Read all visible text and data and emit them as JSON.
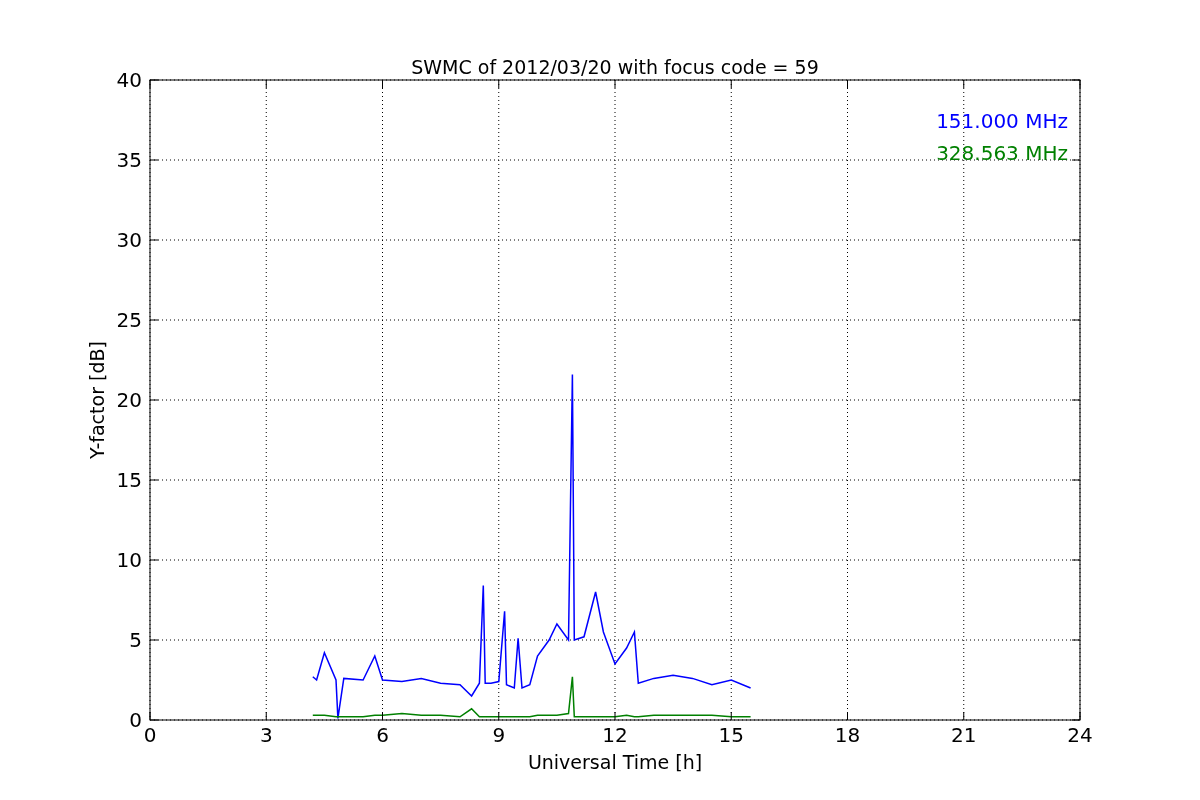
{
  "chart_data": {
    "type": "line",
    "title": "SWMC of 2012/03/20 with focus code = 59",
    "xlabel": "Universal Time [h]",
    "ylabel": "Y-factor [dB]",
    "x": [
      4.2,
      4.3,
      4.5,
      4.8,
      4.85,
      5.0,
      5.5,
      5.8,
      6.0,
      6.5,
      7.0,
      7.5,
      8.0,
      8.3,
      8.5,
      8.6,
      8.65,
      8.8,
      9.0,
      9.15,
      9.2,
      9.4,
      9.5,
      9.6,
      9.8,
      10.0,
      10.3,
      10.5,
      10.8,
      10.9,
      10.95,
      11.2,
      11.5,
      11.7,
      12.0,
      12.3,
      12.5,
      12.6,
      13.0,
      13.5,
      14.0,
      14.5,
      15.0,
      15.5
    ],
    "series": [
      {
        "name": "151.000 MHz",
        "color": "#0000ff",
        "values": [
          2.7,
          2.5,
          4.2,
          2.5,
          0.1,
          2.6,
          2.5,
          4.0,
          2.5,
          2.4,
          2.6,
          2.3,
          2.2,
          1.5,
          2.3,
          8.4,
          2.3,
          2.3,
          2.4,
          6.8,
          2.2,
          2.0,
          5.1,
          2.0,
          2.2,
          4.0,
          5.0,
          6.0,
          5.0,
          21.6,
          5.0,
          5.2,
          8.0,
          5.5,
          3.5,
          4.5,
          5.5,
          2.3,
          2.6,
          2.8,
          2.6,
          2.2,
          2.5,
          2.0
        ]
      },
      {
        "name": "328.563 MHz",
        "color": "#008000",
        "values": [
          0.3,
          0.3,
          0.3,
          0.2,
          0.2,
          0.2,
          0.2,
          0.3,
          0.3,
          0.4,
          0.3,
          0.3,
          0.2,
          0.7,
          0.2,
          0.2,
          0.2,
          0.2,
          0.2,
          0.2,
          0.2,
          0.2,
          0.2,
          0.2,
          0.2,
          0.3,
          0.3,
          0.3,
          0.4,
          2.7,
          0.2,
          0.2,
          0.2,
          0.2,
          0.2,
          0.3,
          0.2,
          0.2,
          0.3,
          0.3,
          0.3,
          0.3,
          0.2,
          0.2
        ]
      }
    ],
    "grid": true,
    "xlim": [
      0,
      24
    ],
    "ylim": [
      0,
      40
    ],
    "xticks": [
      0,
      3,
      6,
      9,
      12,
      15,
      18,
      21,
      24
    ],
    "yticks": [
      0,
      5,
      10,
      15,
      20,
      25,
      30,
      35,
      40
    ]
  }
}
